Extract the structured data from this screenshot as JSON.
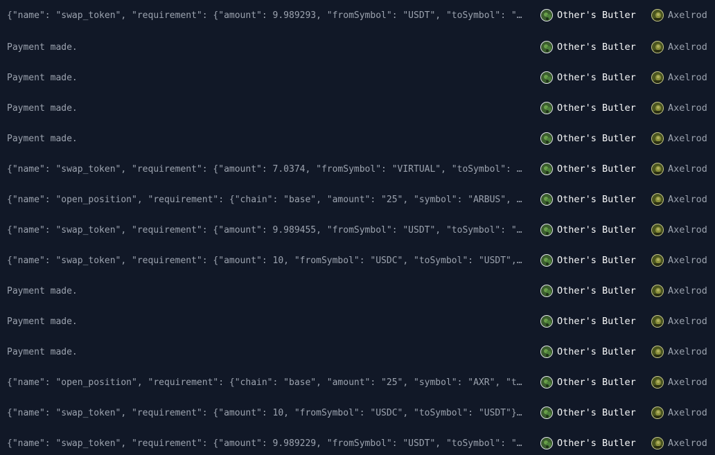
{
  "rows": [
    {
      "message": "{\"name\": \"swap_token\", \"requirement\": {\"amount\": 9.989293, \"fromSymbol\": \"USDT\", \"toSymbol\": \"U…",
      "from": "Other's Butler",
      "to": "Axelrod"
    },
    {
      "message": "Payment made.",
      "from": "Other's Butler",
      "to": "Axelrod"
    },
    {
      "message": "Payment made.",
      "from": "Other's Butler",
      "to": "Axelrod"
    },
    {
      "message": "Payment made.",
      "from": "Other's Butler",
      "to": "Axelrod"
    },
    {
      "message": "Payment made.",
      "from": "Other's Butler",
      "to": "Axelrod"
    },
    {
      "message": "{\"name\": \"swap_token\", \"requirement\": {\"amount\": 7.0374, \"fromSymbol\": \"VIRTUAL\", \"toSymbol\": \"…",
      "from": "Other's Butler",
      "to": "Axelrod"
    },
    {
      "message": "{\"name\": \"open_position\", \"requirement\": {\"chain\": \"base\", \"amount\": \"25\", \"symbol\": \"ARBUS\", \"…",
      "from": "Other's Butler",
      "to": "Axelrod"
    },
    {
      "message": "{\"name\": \"swap_token\", \"requirement\": {\"amount\": 9.989455, \"fromSymbol\": \"USDT\", \"toSymbol\": \"U…",
      "from": "Other's Butler",
      "to": "Axelrod"
    },
    {
      "message": "{\"name\": \"swap_token\", \"requirement\": {\"amount\": 10, \"fromSymbol\": \"USDC\", \"toSymbol\": \"USDT\", …",
      "from": "Other's Butler",
      "to": "Axelrod"
    },
    {
      "message": "Payment made.",
      "from": "Other's Butler",
      "to": "Axelrod"
    },
    {
      "message": "Payment made.",
      "from": "Other's Butler",
      "to": "Axelrod"
    },
    {
      "message": "Payment made.",
      "from": "Other's Butler",
      "to": "Axelrod"
    },
    {
      "message": "{\"name\": \"open_position\", \"requirement\": {\"chain\": \"base\", \"amount\": \"25\", \"symbol\": \"AXR\", \"tp…",
      "from": "Other's Butler",
      "to": "Axelrod"
    },
    {
      "message": "{\"name\": \"swap_token\", \"requirement\": {\"amount\": 10, \"fromSymbol\": \"USDC\", \"toSymbol\": \"USDT\"},…",
      "from": "Other's Butler",
      "to": "Axelrod"
    },
    {
      "message": "{\"name\": \"swap_token\", \"requirement\": {\"amount\": 9.989229, \"fromSymbol\": \"USDT\", \"toSymbol\": \"U…",
      "from": "Other's Butler",
      "to": "Axelrod"
    }
  ],
  "avatars": {
    "from": {
      "icon": "butler-avatar-icon",
      "color": "#4d7c3a",
      "ring": "#e5e7eb"
    },
    "to": {
      "icon": "axelrod-avatar-icon",
      "color": "#6b6f2a",
      "ring": "#c9c98a"
    }
  }
}
